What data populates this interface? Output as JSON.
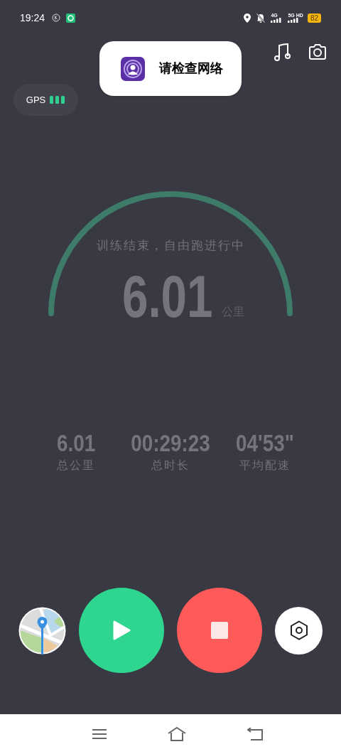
{
  "status_bar": {
    "time": "19:24",
    "network_1": "4G",
    "network_2": "5G HD",
    "battery": "82"
  },
  "gps": {
    "label": "GPS"
  },
  "toast": {
    "message": "请检查网络"
  },
  "gauge": {
    "status": "训练结束，自由跑进行中",
    "distance": "6.01",
    "unit": "公里"
  },
  "stats": [
    {
      "value": "6.01",
      "label": "总公里"
    },
    {
      "value": "00:29:23",
      "label": "总时长"
    },
    {
      "value": "04'53\"",
      "label": "平均配速"
    }
  ]
}
